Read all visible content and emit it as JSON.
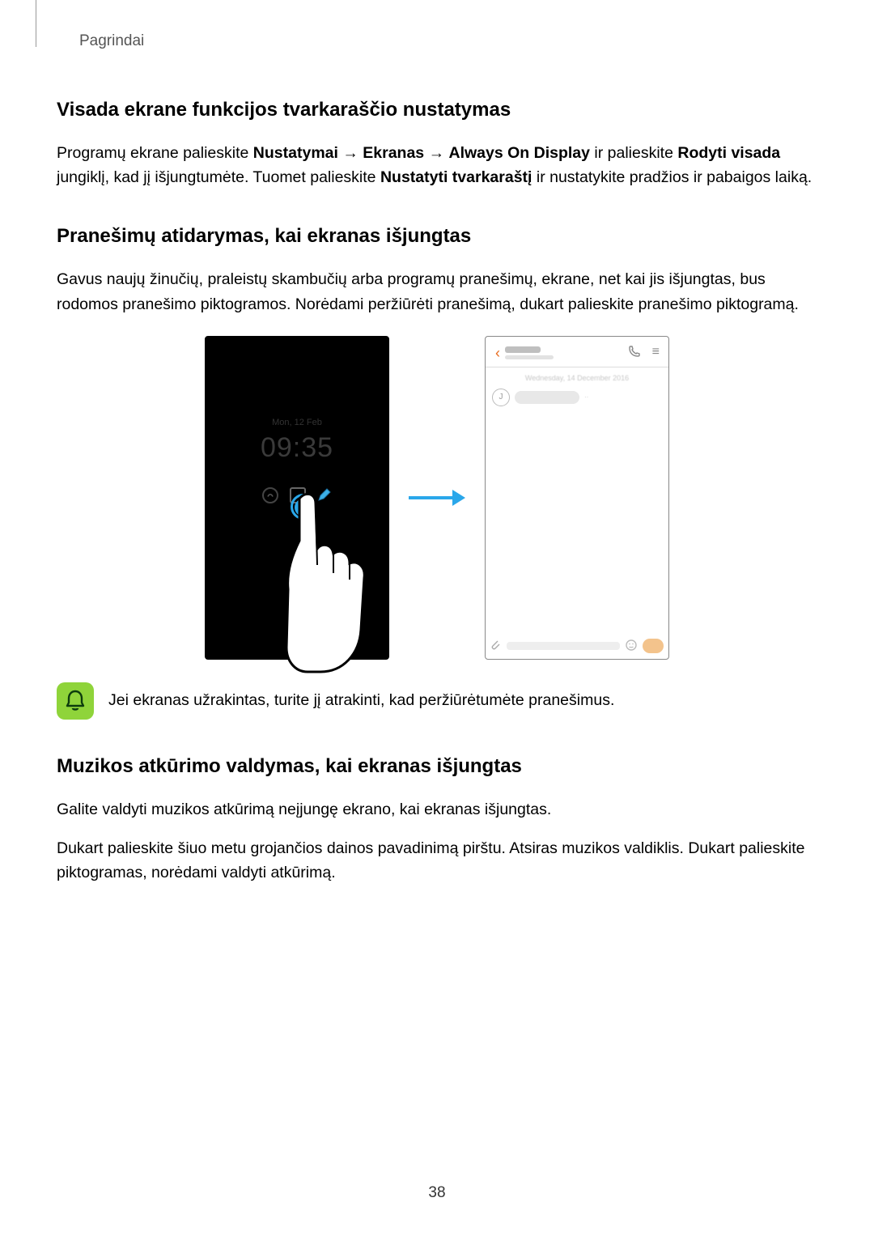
{
  "header": "Pagrindai",
  "section1": {
    "title": "Visada ekrane funkcijos tvarkaraščio nustatymas",
    "p1_a": "Programų ekrane palieskite ",
    "p1_b": "Nustatymai",
    "p1_c": " → ",
    "p1_d": "Ekranas",
    "p1_e": " → ",
    "p1_f": "Always On Display",
    "p1_g": " ir palieskite ",
    "p1_h": "Rodyti visada",
    "p1_i": " jungiklį, kad jį išjungtumėte. Tuomet palieskite ",
    "p1_j": "Nustatyti tvarkaraštį",
    "p1_k": " ir nustatykite pradžios ir pabaigos laiką."
  },
  "section2": {
    "title": "Pranešimų atidarymas, kai ekranas išjungtas",
    "p1": "Gavus naujų žinučių, praleistų skambučių arba programų pranešimų, ekrane, net kai jis išjungtas, bus rodomos pranešimo piktogramos. Norėdami peržiūrėti pranešimą, dukart palieskite pranešimo piktogramą."
  },
  "figure": {
    "aod_day": "Mon, 12 Feb",
    "aod_time": "09:35",
    "aod_sub": " ",
    "chat_avatar": "J",
    "chat_date": "Wednesday, 14 December 2016"
  },
  "note": {
    "text": "Jei ekranas užrakintas, turite jį atrakinti, kad peržiūrėtumėte pranešimus."
  },
  "section3": {
    "title": "Muzikos atkūrimo valdymas, kai ekranas išjungtas",
    "p1": "Galite valdyti muzikos atkūrimą neįjungę ekrano, kai ekranas išjungtas.",
    "p2": "Dukart palieskite šiuo metu grojančios dainos pavadinimą pirštu. Atsiras muzikos valdiklis. Dukart palieskite piktogramas, norėdami valdyti atkūrimą."
  },
  "page_number": "38"
}
